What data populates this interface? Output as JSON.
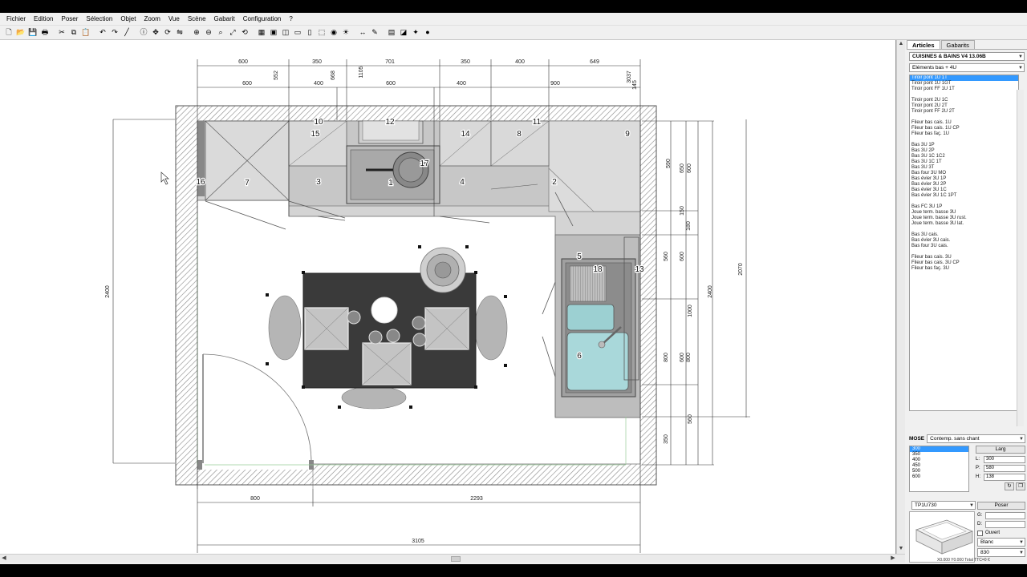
{
  "menu": [
    "Fichier",
    "Edition",
    "Poser",
    "Sélection",
    "Objet",
    "Zoom",
    "Vue",
    "Scène",
    "Gabarit",
    "Configuration",
    "?"
  ],
  "toolbar_icons": [
    "new-icon",
    "open-icon",
    "save-icon",
    "print-icon",
    "sep",
    "cut-icon",
    "copy-icon",
    "paste-icon",
    "sep",
    "undo-icon",
    "redo-icon",
    "line-icon",
    "sep",
    "info-icon",
    "move-icon",
    "rotate-icon",
    "mirror-icon",
    "sep",
    "zoom-in-icon",
    "zoom-out-icon",
    "zoom-window-icon",
    "zoom-fit-icon",
    "zoom-previous-icon",
    "sep",
    "view-2d-icon",
    "view-plan-icon",
    "view-3d-icon",
    "view-front-icon",
    "view-side-icon",
    "box-icon",
    "camera-icon",
    "light-icon",
    "sep",
    "measure-icon",
    "paint-icon",
    "sep",
    "wall-icon",
    "door-icon",
    "render-icon",
    "sphere-icon"
  ],
  "panel": {
    "tabs": [
      "Articles",
      "Gabarits"
    ],
    "catalog": "CUISINES & BAINS V4 13.06B",
    "category": "Eléments bas + 4U",
    "articles": [
      "Tiroir pont 1U 1T",
      "Tiroir pont 1U 1GT",
      "Tiroir pont FF 1U 1T",
      "",
      "Tiroir pont 2U 1C",
      "Tiroir pont 2U 2T",
      "Tiroir pont FF 2U 2T",
      "",
      "Fileur bas cais. 1U",
      "Fileur bas cais. 1U CP",
      "Fileur bas faç. 1U",
      "",
      "Bas 3U 1P",
      "Bas 3U 2P",
      "Bas 3U 1C 1C2",
      "Bas 3U 1C 1T",
      "Bas 3U 3T",
      "Bas four 3U MO",
      "Bas évier 3U 1P",
      "Bas évier 3U 2P",
      "Bas évier 3U 1C",
      "Bas évier 3U 1C 1PT",
      "",
      "Bas FC 3U 1P",
      "Joue term. basse 3U",
      "Joue term. basse 3U rust.",
      "Joue term. basse 3U lat.",
      "",
      "Bas 3U cais.",
      "Bas évier 3U cais.",
      "Bas four 3U cais.",
      "",
      "Fileur bas cais. 3U",
      "Fileur bas cais. 3U CP",
      "Fileur bas faç. 3U"
    ],
    "finish_label": "MOSE",
    "finish_value": "Contemp. sans chant",
    "dims": [
      "300",
      "350",
      "400",
      "450",
      "500",
      "600"
    ],
    "dim_button": "Larg",
    "fields": [
      {
        "label": "L:",
        "value": "300"
      },
      {
        "label": "P:",
        "value": "580"
      },
      {
        "label": "H:",
        "value": "138"
      }
    ],
    "color_code": "TP1U730",
    "pose_button": "Poser",
    "g_label": "G:",
    "d_label": "D:",
    "ouvert_label": "Ouvert",
    "color_name": "Blanc",
    "color_value": "830",
    "status": "X0.000 Y0.000 Total TTC=0 €"
  },
  "plan": {
    "top_dims_row1": [
      "600",
      "350",
      "701",
      "350",
      "400",
      "649"
    ],
    "top_dims_row2": [
      "600",
      "400",
      "600",
      "400",
      "900"
    ],
    "small_top": [
      "552",
      "668",
      "1105",
      "3037",
      "145"
    ],
    "left_dim": "2400",
    "right_dims_a": [
      "590",
      "650",
      "600",
      "150",
      "180",
      "560",
      "1000",
      "800",
      "560",
      "350"
    ],
    "right_dims_b": [
      "600",
      "600",
      "800"
    ],
    "right_total": "2400",
    "right_far": "2070",
    "bottom_dims": [
      "800",
      "2293"
    ],
    "bottom_total": "3105",
    "labels": [
      "1",
      "2",
      "3",
      "4",
      "5",
      "6",
      "7",
      "8",
      "9",
      "10",
      "11",
      "12",
      "13",
      "14",
      "15",
      "16",
      "17",
      "18"
    ]
  }
}
